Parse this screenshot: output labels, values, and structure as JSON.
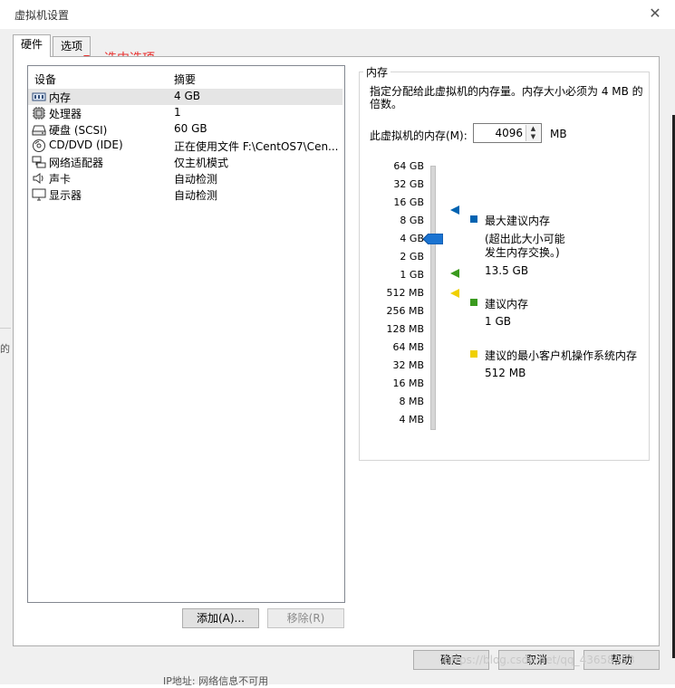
{
  "window": {
    "title": "虚拟机设置",
    "close_glyph": "✕"
  },
  "tabs": [
    {
      "label": "硬件"
    },
    {
      "label": "选项"
    }
  ],
  "annotation": {
    "text": "选中选项",
    "color": "#e8312f"
  },
  "device_table": {
    "columns": [
      "设备",
      "摘要"
    ],
    "rows": [
      {
        "icon": "memory-icon",
        "device": "内存",
        "summary": "4 GB",
        "selected": true
      },
      {
        "icon": "processor-icon",
        "device": "处理器",
        "summary": "1"
      },
      {
        "icon": "hard-disk-icon",
        "device": "硬盘 (SCSI)",
        "summary": "60 GB"
      },
      {
        "icon": "cd-dvd-icon",
        "device": "CD/DVD (IDE)",
        "summary": "正在使用文件 F:\\CentOS7\\Cen..."
      },
      {
        "icon": "network-adapter-icon",
        "device": "网络适配器",
        "summary": "仅主机模式"
      },
      {
        "icon": "sound-card-icon",
        "device": "声卡",
        "summary": "自动检测"
      },
      {
        "icon": "display-icon",
        "device": "显示器",
        "summary": "自动检测"
      }
    ]
  },
  "device_buttons": {
    "add": "添加(A)...",
    "remove": "移除(R)"
  },
  "memory": {
    "group_title": "内存",
    "description": "指定分配给此虚拟机的内存量。内存大小必须为 4 MB 的倍数。",
    "field_label": "此虚拟机的内存(M):",
    "value": "4096",
    "unit": "MB",
    "scale_ticks": [
      "64 GB",
      "32 GB",
      "16 GB",
      "8 GB",
      "4 GB",
      "2 GB",
      "1 GB",
      "512 MB",
      "256 MB",
      "128 MB",
      "64 MB",
      "32 MB",
      "16 MB",
      "8 MB",
      "4 MB"
    ],
    "current_tick_index": 4,
    "max_recommended": {
      "label": "最大建议内存",
      "note": "(超出此大小可能发生内存交换。)",
      "value": "13.5 GB",
      "color": "#0063b1",
      "tick_position": 2.4
    },
    "recommended": {
      "label": "建议内存",
      "value": "1 GB",
      "color": "#3a9a1e",
      "tick_position": 5.9
    },
    "min_guest": {
      "label": "建议的最小客户机操作系统内存",
      "value": "512 MB",
      "color": "#f0d000",
      "tick_position": 7.0
    }
  },
  "footer": {
    "ok": "确定",
    "cancel": "取消",
    "help": "帮助"
  },
  "left_strip_text": "的",
  "background_text": "IP地址: 网络信息不可用",
  "watermark": "https://blog.csdn.net/qq_43658953"
}
